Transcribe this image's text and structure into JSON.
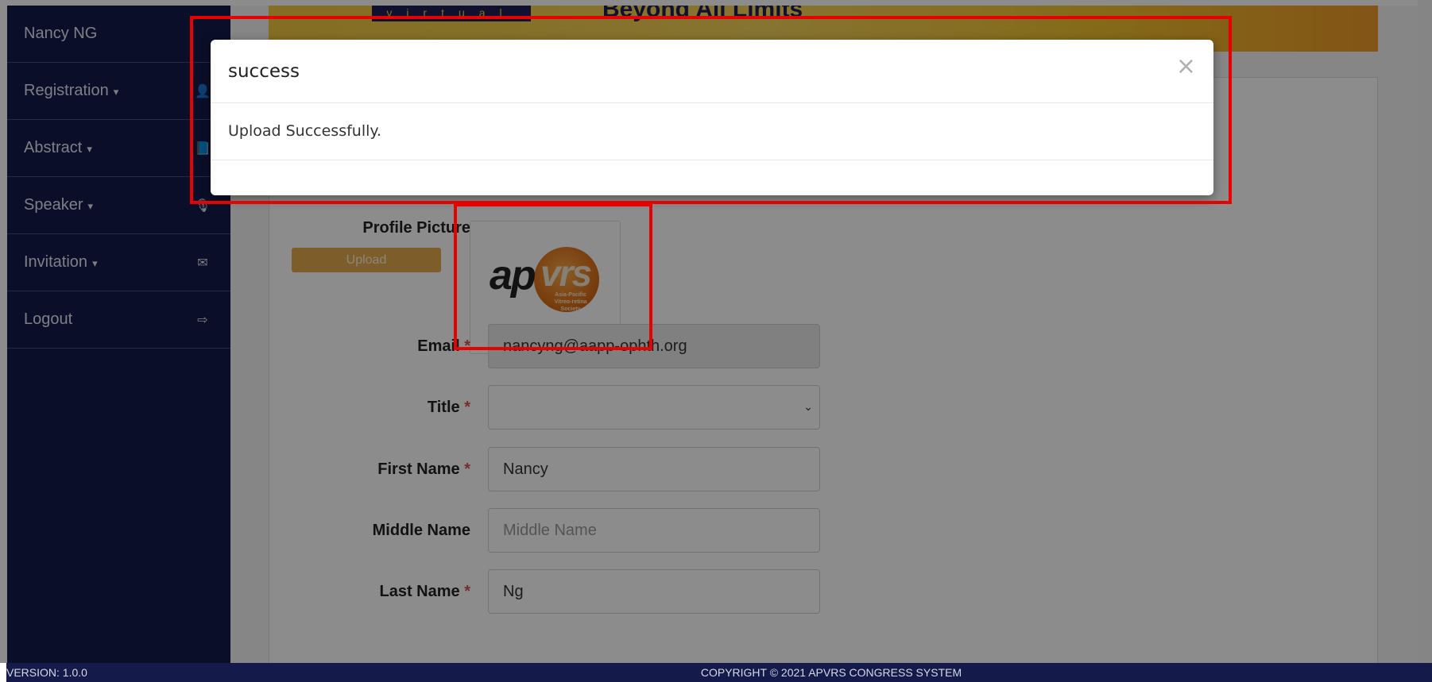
{
  "sidebar": {
    "user_name": "Nancy NG",
    "items": [
      {
        "label": "Registration",
        "icon": "user-icon",
        "caret": "▾",
        "glyph": "👤"
      },
      {
        "label": "Abstract",
        "icon": "book-icon",
        "caret": "▾",
        "glyph": "📘"
      },
      {
        "label": "Speaker",
        "icon": "microphone-icon",
        "caret": "▾",
        "glyph": "🎙"
      },
      {
        "label": "Invitation",
        "icon": "envelope-icon",
        "caret": "▾",
        "glyph": "✉"
      },
      {
        "label": "Logout",
        "icon": "sign-out-icon",
        "caret": "",
        "glyph": "⇨"
      }
    ],
    "version": "VERSION: 1.0.0"
  },
  "banner": {
    "logo_text": "virtual",
    "tagline": "Beyond All Limits"
  },
  "profile": {
    "picture_label": "Profile Picture",
    "upload_label": "Upload",
    "logo": {
      "ap": "ap",
      "vrs": "vrs",
      "society": "Asia-Pacific Vitreo-retina Society"
    }
  },
  "form": {
    "required_marker": "*",
    "email": {
      "label": "Email",
      "value": "nancyng@aapp-ophth.org"
    },
    "title": {
      "label": "Title",
      "value": "",
      "chevron": "⌄"
    },
    "first_name": {
      "label": "First Name",
      "value": "Nancy"
    },
    "middle_name": {
      "label": "Middle Name",
      "placeholder": "Middle Name"
    },
    "last_name": {
      "label": "Last Name",
      "value": "Ng"
    }
  },
  "footer": {
    "copyright": "COPYRIGHT © 2021 APVRS CONGRESS SYSTEM"
  },
  "modal": {
    "title": "success",
    "message": "Upload Successfully.",
    "close_glyph": "×"
  },
  "colors": {
    "sidebar_bg": "#141a4a",
    "highlight": "#e60000",
    "upload_button": "#e3a94b",
    "required": "#d9534f"
  }
}
